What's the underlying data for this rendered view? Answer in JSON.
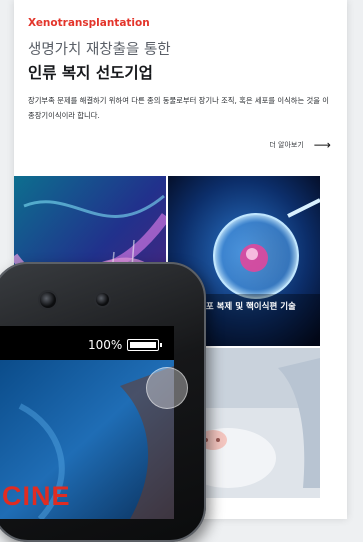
{
  "section": {
    "eyebrow": "Xenotransplantation",
    "subtitle": "생명가치 재창출을 통한",
    "title": "인류 복지 선도기업",
    "description": "장기부족 문제를 해결하기 위하여 다른 종의 동물로부터 장기나 조직, 혹은 세포를 이식하는 것을 이종장기이식이라 합니다.",
    "more_label": "더 알아보기",
    "more_icon": "arrow-right-icon"
  },
  "tiles": {
    "cell_caption": "세포 복제 및 핵이식편 기술"
  },
  "phone": {
    "battery_text": "100%",
    "screen_word": "CINE"
  },
  "colors": {
    "accent": "#e3342a"
  }
}
